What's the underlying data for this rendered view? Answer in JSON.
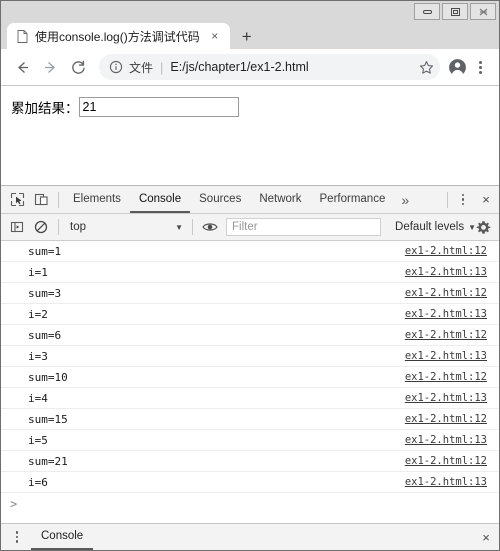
{
  "window": {
    "minimize_label": "minimize",
    "restore_label": "restore",
    "close_label": "close"
  },
  "tabs": {
    "items": [
      {
        "title": "使用console.log()方法调试代码",
        "favicon": "page-icon",
        "close": "×"
      }
    ],
    "new_tab_label": "+"
  },
  "toolbar": {
    "back_label": "←",
    "forward_label": "→",
    "reload_label": "C",
    "info_icon": "info-circle-icon",
    "scheme_label": "文件",
    "scheme_separator": "|",
    "url": "E:/js/chapter1/ex1-2.html",
    "bookmark_icon": "star-icon",
    "profile_icon": "avatar-icon",
    "menu_icon": "kebab-menu-icon"
  },
  "page": {
    "result_label": "累加结果：",
    "result_value": "21",
    "result_placeholder": ""
  },
  "devtools": {
    "inspect_icon": "inspect-element-icon",
    "device_icon": "device-toolbar-icon",
    "tabs": [
      {
        "label": "Elements",
        "active": false
      },
      {
        "label": "Console",
        "active": true
      },
      {
        "label": "Sources",
        "active": false
      },
      {
        "label": "Network",
        "active": false
      },
      {
        "label": "Performance",
        "active": false
      }
    ],
    "more_tabs_label": "»",
    "menu_icon": "kebab-menu-icon",
    "close_label": "×",
    "filterbar": {
      "sidebar_icon": "console-sidebar-icon",
      "clear_icon": "clear-console-icon",
      "context": "top",
      "context_caret": "▼",
      "eye_icon": "live-expression-icon",
      "filter_placeholder": "Filter",
      "filter_value": "",
      "levels_label": "Default levels",
      "levels_caret": "▼",
      "settings_icon": "gear-icon"
    },
    "logs": [
      {
        "message": "sum=1",
        "source": "ex1-2.html:12"
      },
      {
        "message": "i=1",
        "source": "ex1-2.html:13"
      },
      {
        "message": "sum=3",
        "source": "ex1-2.html:12"
      },
      {
        "message": "i=2",
        "source": "ex1-2.html:13"
      },
      {
        "message": "sum=6",
        "source": "ex1-2.html:12"
      },
      {
        "message": "i=3",
        "source": "ex1-2.html:13"
      },
      {
        "message": "sum=10",
        "source": "ex1-2.html:12"
      },
      {
        "message": "i=4",
        "source": "ex1-2.html:13"
      },
      {
        "message": "sum=15",
        "source": "ex1-2.html:12"
      },
      {
        "message": "i=5",
        "source": "ex1-2.html:13"
      },
      {
        "message": "sum=21",
        "source": "ex1-2.html:12"
      },
      {
        "message": "i=6",
        "source": "ex1-2.html:13"
      }
    ],
    "prompt_symbol": ">",
    "drawer": {
      "menu_icon": "kebab-menu-icon",
      "tab_label": "Console",
      "close_label": "×"
    }
  }
}
